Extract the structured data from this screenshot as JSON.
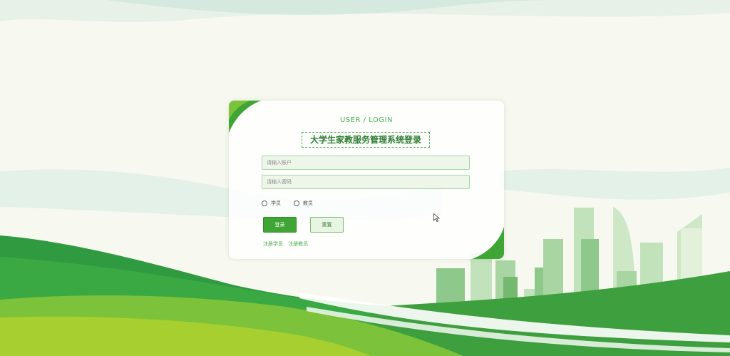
{
  "login": {
    "subtitle": "USER / LOGIN",
    "title": "大学生家教服务管理系统登录",
    "username_placeholder": "请输入账户",
    "password_placeholder": "请输入密码",
    "roles": [
      "学员",
      "教员"
    ],
    "login_button": "登录",
    "reset_button": "重置",
    "register_links": [
      "注册学员",
      "注册教员"
    ]
  },
  "colors": {
    "accent": "#3fa535",
    "dark_green": "#2e7d32",
    "light_green": "#a5d6a7"
  }
}
